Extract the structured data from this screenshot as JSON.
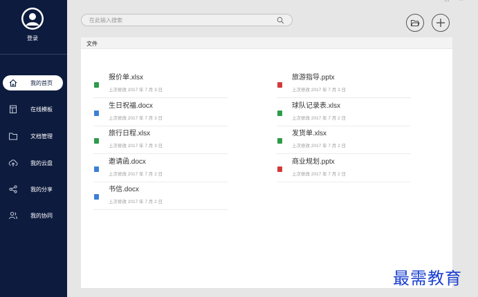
{
  "window": {
    "minimize": "−",
    "maximize": "□",
    "close": "×"
  },
  "sidebar": {
    "login_label": "登录",
    "items": [
      {
        "label": "我的首页",
        "icon": "home-icon",
        "active": true
      },
      {
        "label": "在线模板",
        "icon": "template-icon",
        "active": false
      },
      {
        "label": "文档管理",
        "icon": "folder-icon",
        "active": false
      },
      {
        "label": "我的云盘",
        "icon": "cloud-upload-icon",
        "active": false
      },
      {
        "label": "我的分享",
        "icon": "share-icon",
        "active": false
      },
      {
        "label": "我的协同",
        "icon": "collaboration-icon",
        "active": false
      }
    ]
  },
  "search": {
    "placeholder": "在此输入搜索",
    "value": ""
  },
  "toolbar": {
    "open_icon": "open-folder-icon",
    "new_icon": "plus-icon"
  },
  "panel": {
    "title": "文件",
    "files": [
      {
        "name": "报价单.xlsx",
        "meta": "上次修改 2017 年 7 月 3 日",
        "type": "xlsx"
      },
      {
        "name": "旅游指导.pptx",
        "meta": "上次修改 2017 年 7 月 3 日",
        "type": "pptx"
      },
      {
        "name": "生日祝福.docx",
        "meta": "上次修改 2017 年 7 月 3 日",
        "type": "docx"
      },
      {
        "name": "球队记录表.xlsx",
        "meta": "上次修改 2017 年 7 月 2 日",
        "type": "xlsx"
      },
      {
        "name": "旅行日程.xlsx",
        "meta": "上次修改 2017 年 7 月 3 日",
        "type": "xlsx"
      },
      {
        "name": "发货单.xlsx",
        "meta": "上次修改 2017 年 7 月 2 日",
        "type": "xlsx"
      },
      {
        "name": "邀请函.docx",
        "meta": "上次修改 2017 年 7 月 2 日",
        "type": "docx"
      },
      {
        "name": "商业规划.pptx",
        "meta": "上次修改 2017 年 7 月 2 日",
        "type": "pptx"
      },
      {
        "name": "书信.docx",
        "meta": "上次修改 2017 年 7 月 2 日",
        "type": "docx"
      }
    ]
  },
  "file_type_colors": {
    "xlsx": "#2e9b4a",
    "docx": "#3d7fd6",
    "pptx": "#d23a3a"
  },
  "watermark": "最需教育"
}
